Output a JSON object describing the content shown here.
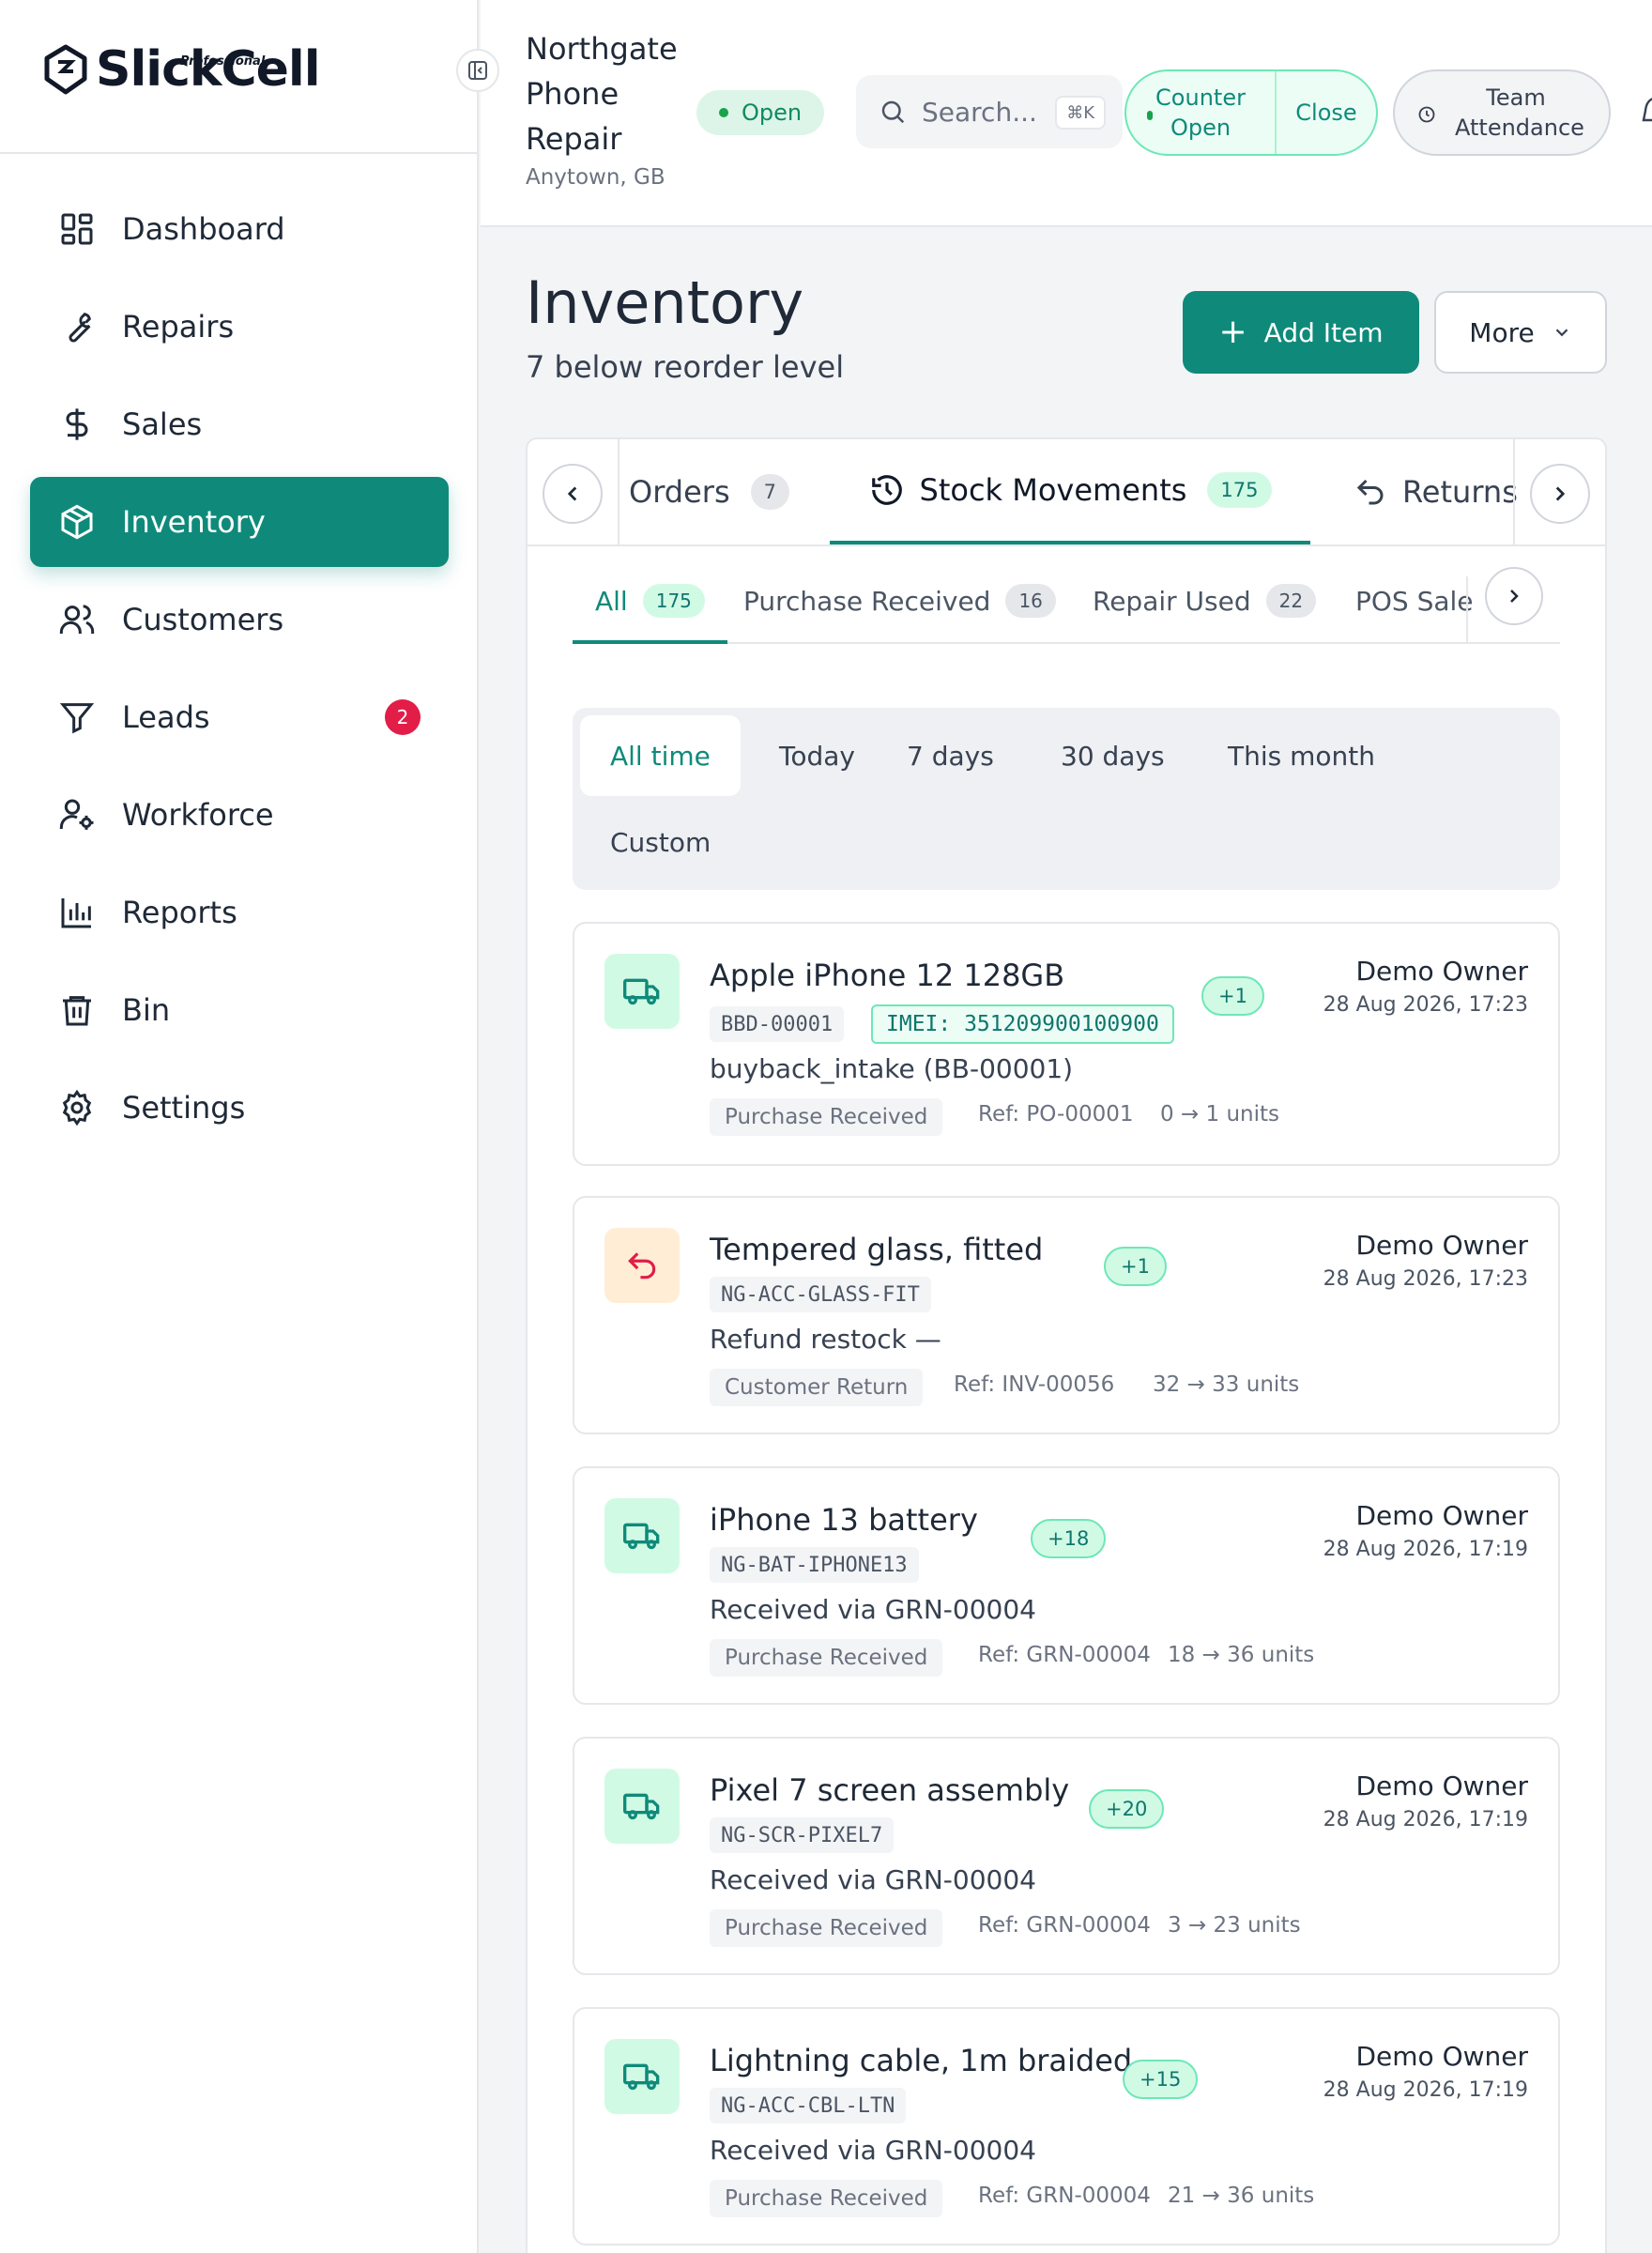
{
  "brand": {
    "name": "SlickCell",
    "tier": "Professional"
  },
  "sidebar": {
    "items": [
      {
        "label": "Dashboard"
      },
      {
        "label": "Repairs"
      },
      {
        "label": "Sales"
      },
      {
        "label": "Inventory",
        "active": true
      },
      {
        "label": "Customers"
      },
      {
        "label": "Leads",
        "badge": "2"
      },
      {
        "label": "Workforce"
      },
      {
        "label": "Reports"
      },
      {
        "label": "Bin"
      },
      {
        "label": "Settings"
      }
    ]
  },
  "header": {
    "store_name": "Northgate Phone Repair",
    "store_location": "Anytown, GB",
    "status": "Open",
    "search_placeholder": "Search...",
    "search_shortcut": "⌘K",
    "counter_open_label": "Counter Open",
    "counter_close_label": "Close",
    "team_attendance_label": "Team Attendance"
  },
  "page": {
    "title": "Inventory",
    "subtitle": "7 below reorder level",
    "add_item_label": "Add Item",
    "more_label": "More"
  },
  "tabs": [
    {
      "label": "Orders",
      "count": "7"
    },
    {
      "label": "Stock Movements",
      "count": "175"
    },
    {
      "label": "Returns"
    }
  ],
  "filter_tabs": [
    {
      "label": "All",
      "count": "175"
    },
    {
      "label": "Purchase Received",
      "count": "16"
    },
    {
      "label": "Repair Used",
      "count": "22"
    },
    {
      "label": "POS Sale"
    }
  ],
  "ranges": [
    "All time",
    "Today",
    "7 days",
    "30 days",
    "This month",
    "Custom"
  ],
  "movements": [
    {
      "name": "Apple iPhone 12 128GB",
      "delta": "+1",
      "sku": "BBD-00001",
      "imei": "IMEI: 351209900100900",
      "note": "buyback_intake (BB-00001)",
      "type": "Purchase Received",
      "ref": "Ref: PO-00001",
      "units": "0 → 1 units",
      "owner": "Demo Owner",
      "when": "28 Aug 2026, 17:23",
      "icon": "truck-icon"
    },
    {
      "name": "Tempered glass, fitted",
      "delta": "+1",
      "sku": "NG-ACC-GLASS-FIT",
      "note": "Refund restock —",
      "type": "Customer Return",
      "ref": "Ref: INV-00056",
      "units": "32 → 33 units",
      "owner": "Demo Owner",
      "when": "28 Aug 2026, 17:23",
      "icon": "undo-icon"
    },
    {
      "name": "iPhone 13 battery",
      "delta": "+18",
      "sku": "NG-BAT-IPHONE13",
      "note": "Received via GRN-00004",
      "type": "Purchase Received",
      "ref": "Ref: GRN-00004",
      "units": "18 → 36 units",
      "owner": "Demo Owner",
      "when": "28 Aug 2026, 17:19",
      "icon": "truck-icon"
    },
    {
      "name": "Pixel 7 screen assembly",
      "delta": "+20",
      "sku": "NG-SCR-PIXEL7",
      "note": "Received via GRN-00004",
      "type": "Purchase Received",
      "ref": "Ref: GRN-00004",
      "units": "3 → 23 units",
      "owner": "Demo Owner",
      "when": "28 Aug 2026, 17:19",
      "icon": "truck-icon"
    },
    {
      "name": "Lightning cable, 1m braided",
      "delta": "+15",
      "sku": "NG-ACC-CBL-LTN",
      "note": "Received via GRN-00004",
      "type": "Purchase Received",
      "ref": "Ref: GRN-00004",
      "units": "21 → 36 units",
      "owner": "Demo Owner",
      "when": "28 Aug 2026, 17:19",
      "icon": "truck-icon"
    }
  ],
  "colors": {
    "accent": "#0f8a7a",
    "success_bg": "#d1fae5",
    "danger": "#e11d48",
    "warn_bg": "#ffedd5"
  }
}
